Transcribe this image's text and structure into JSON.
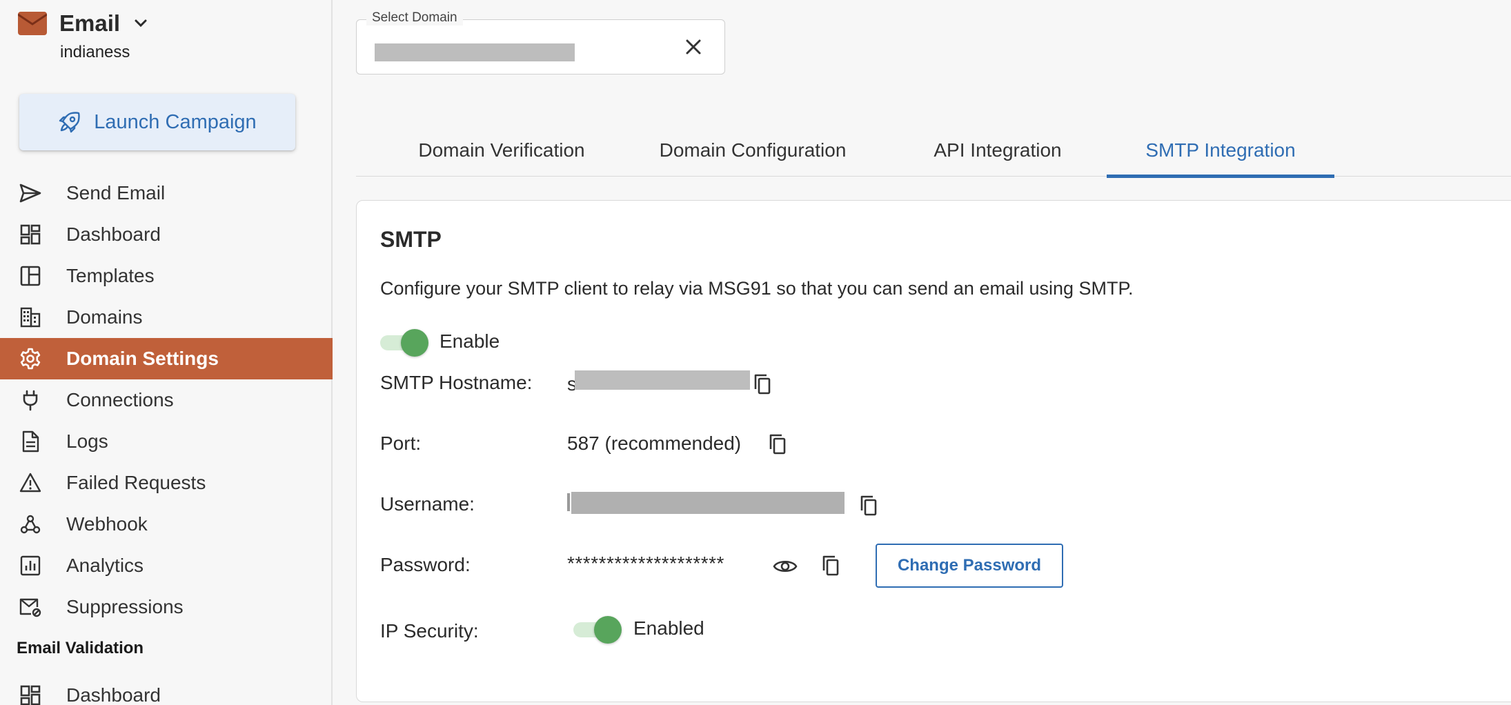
{
  "app": {
    "title": "Email",
    "account": "indianess",
    "brand_color": "#c0603a"
  },
  "sidebar": {
    "launch_label": "Launch Campaign",
    "items": [
      {
        "label": "Send Email",
        "icon": "send-icon"
      },
      {
        "label": "Dashboard",
        "icon": "dashboard-icon"
      },
      {
        "label": "Templates",
        "icon": "templates-icon"
      },
      {
        "label": "Domains",
        "icon": "building-icon"
      },
      {
        "label": "Domain Settings",
        "icon": "gear-icon",
        "active": true
      },
      {
        "label": "Connections",
        "icon": "plug-icon"
      },
      {
        "label": "Logs",
        "icon": "document-icon"
      },
      {
        "label": "Failed Requests",
        "icon": "warning-icon"
      },
      {
        "label": "Webhook",
        "icon": "webhook-icon"
      },
      {
        "label": "Analytics",
        "icon": "analytics-icon"
      },
      {
        "label": "Suppressions",
        "icon": "mail-block-icon"
      }
    ],
    "section_heading": "Email Validation",
    "section_items": [
      {
        "label": "Dashboard",
        "icon": "dashboard-icon"
      }
    ]
  },
  "domain_select": {
    "label": "Select Domain"
  },
  "tabs": [
    {
      "label": "Domain Verification"
    },
    {
      "label": "Domain Configuration"
    },
    {
      "label": "API Integration"
    },
    {
      "label": "SMTP Integration",
      "active": true
    }
  ],
  "smtp": {
    "title": "SMTP",
    "description": "Configure your SMTP client to relay via MSG91 so that you can send an email using SMTP.",
    "enable_label": "Enable",
    "enabled": true,
    "hostname_label": "SMTP Hostname:",
    "hostname_prefix": "s",
    "port_label": "Port:",
    "port_value": "587 (recommended)",
    "username_label": "Username:",
    "password_label": "Password:",
    "password_value": "********************",
    "change_password_label": "Change Password",
    "ip_security_label": "IP Security:",
    "ip_security_value": "Enabled",
    "ip_security_on": true,
    "accent_color": "#2f6db3",
    "toggle_color": "#58a55c"
  }
}
